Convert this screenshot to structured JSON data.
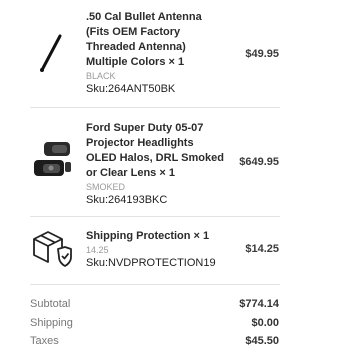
{
  "items": [
    {
      "title": ".50 Cal Bullet Antenna (Fits OEM Factory Threaded Antenna) Multiple Colors × 1",
      "variant": "BLACK",
      "sku": "Sku:264ANT50BK",
      "price": "$49.95",
      "icon": "antenna-icon"
    },
    {
      "title": "Ford Super Duty 05-07 Projector Headlights OLED Halos, DRL Smoked or Clear Lens × 1",
      "variant": "SMOKED",
      "sku": "Sku:264193BKC",
      "price": "$649.95",
      "icon": "headlights-icon"
    },
    {
      "title": "Shipping Protection × 1",
      "variant": "14.25",
      "sku": "Sku:NVDPROTECTION19",
      "price": "$14.25",
      "icon": "shipping-protection-icon"
    }
  ],
  "totals": {
    "subtotal_label": "Subtotal",
    "subtotal_value": "$774.14",
    "shipping_label": "Shipping",
    "shipping_value": "$0.00",
    "taxes_label": "Taxes",
    "taxes_value": "$45.50"
  }
}
